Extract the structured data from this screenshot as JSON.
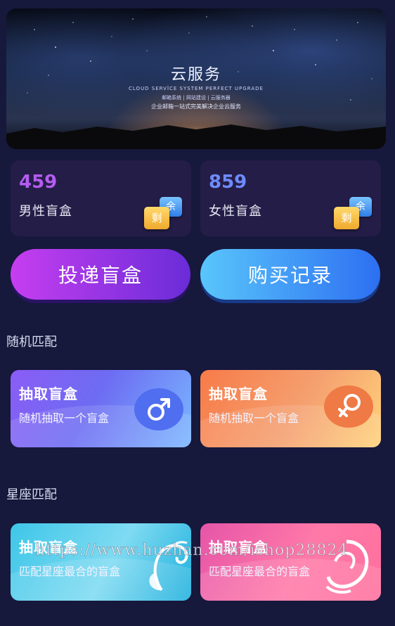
{
  "banner": {
    "title": "云服务",
    "sub1": "CLOUD SERVICE SYSTEM PERFECT UPGRADE",
    "sub2": "邮箱系统 | 网站建设 | 云服务器",
    "sub3": "企业邮箱一站式完美解决企业云服务"
  },
  "stats": [
    {
      "count": "459",
      "label": "男性盲盒",
      "badge_top": "余",
      "badge_bottom": "剩",
      "color": "#b45cf0"
    },
    {
      "count": "859",
      "label": "女性盲盒",
      "badge_top": "余",
      "badge_bottom": "剩",
      "color": "#6e8bff"
    }
  ],
  "actions": {
    "send_label": "投递盲盒",
    "buy_label": "购买记录"
  },
  "sections": {
    "random": "随机匹配",
    "zodiac": "星座匹配"
  },
  "cards": [
    {
      "title": "抽取盲盒",
      "subtitle": "随机抽取一个盲盒",
      "icon": "male-icon"
    },
    {
      "title": "抽取盲盒",
      "subtitle": "随机抽取一个盲盒",
      "icon": "female-icon"
    },
    {
      "title": "抽取盲盒",
      "subtitle": "匹配星座最合的盲盒",
      "icon": "aries-portrait-icon"
    },
    {
      "title": "抽取盲盒",
      "subtitle": "匹配星座最合的盲盒",
      "icon": "virgo-portrait-icon"
    }
  ],
  "watermark": "https://www.huzhan.com/ishop28824"
}
